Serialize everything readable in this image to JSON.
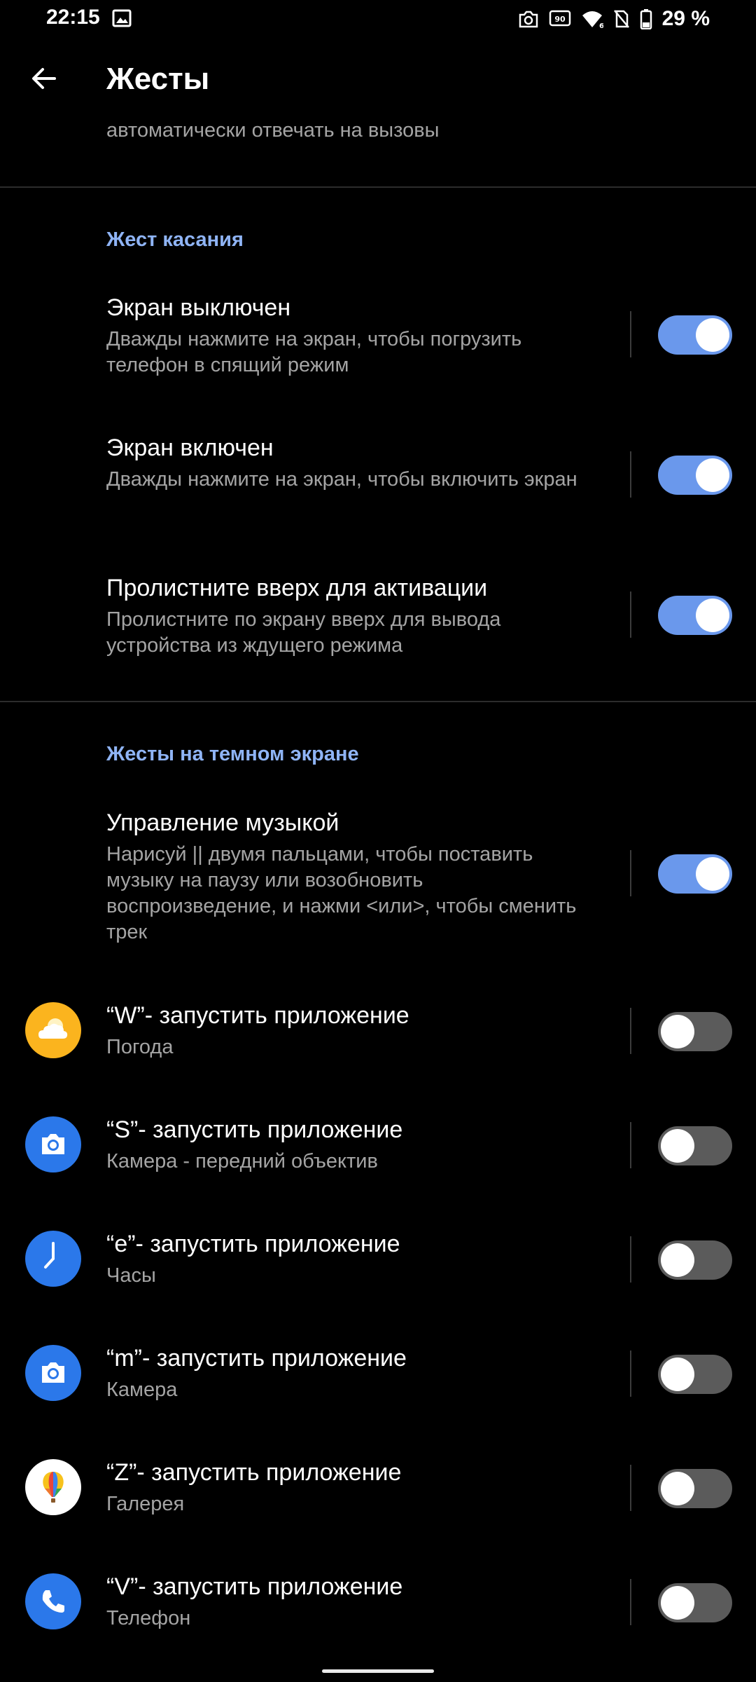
{
  "status_bar": {
    "time": "22:15",
    "battery": "29 %",
    "icons": [
      "gallery-icon",
      "screenshot-icon",
      "refresh-rate-icon",
      "wifi-icon",
      "no-sim-icon",
      "battery-icon"
    ]
  },
  "app_bar": {
    "title": "Жесты",
    "back_icon": "arrow-back-icon"
  },
  "cut_summary": "автоматически отвечать на вызовы",
  "section_touch": {
    "header": "Жест касания",
    "items": [
      {
        "title": "Экран выключен",
        "summary": "Дважды нажмите на экран, чтобы погрузить телефон в спящий режим",
        "enabled": true
      },
      {
        "title": "Экран включен",
        "summary": "Дважды нажмите на экран, чтобы включить экран",
        "enabled": true
      },
      {
        "title": "Пролистните вверх для активации",
        "summary": "Пролистните по экрану вверх для вывода устройства из ждущего режима",
        "enabled": true
      }
    ]
  },
  "section_dark": {
    "header": "Жесты на темном экране",
    "music": {
      "title": "Управление музыкой",
      "summary": "Нарисуй || двумя пальцами, чтобы поставить музыку на паузу или возобновить воспроизведение, и нажми <или>, чтобы сменить трек",
      "enabled": true
    },
    "apps": [
      {
        "title": "“W”- запустить приложение",
        "summary": "Погода",
        "icon": "weather-icon",
        "enabled": false
      },
      {
        "title": "“S”- запустить приложение",
        "summary": "Камера - передний объектив",
        "icon": "camera-icon",
        "enabled": false
      },
      {
        "title": "“e”- запустить приложение",
        "summary": "Часы",
        "icon": "clock-icon",
        "enabled": false
      },
      {
        "title": "“m”- запустить приложение",
        "summary": "Камера",
        "icon": "camera-icon",
        "enabled": false
      },
      {
        "title": "“Z”- запустить приложение",
        "summary": "Галерея",
        "icon": "gallery-balloon-icon",
        "enabled": false
      },
      {
        "title": "“V”- запустить приложение",
        "summary": "Телефон",
        "icon": "phone-icon",
        "enabled": false
      }
    ]
  },
  "colors": {
    "accent": "#8fb4f5",
    "toggle_on": "#6a98ec",
    "toggle_off": "#5b5b5b",
    "background": "#000000",
    "summary_text": "#a4a4a4",
    "weather_icon_bg": "#fbb41e",
    "app_icon_blue": "#2b78ea"
  }
}
